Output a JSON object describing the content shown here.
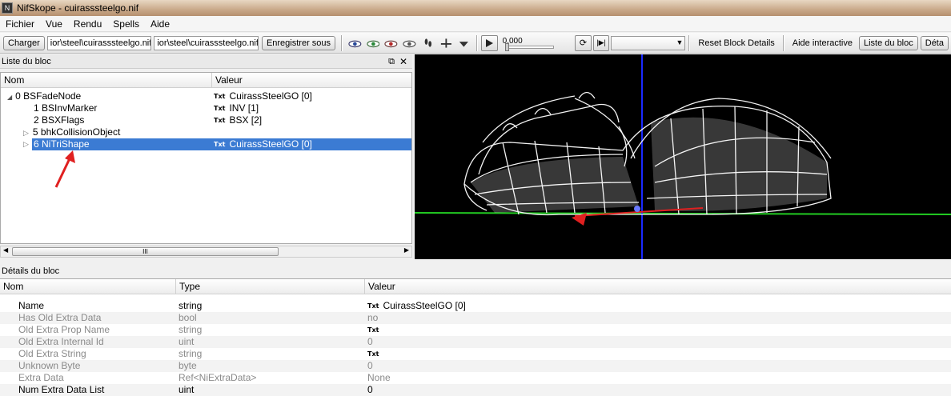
{
  "window": {
    "title": "NifSkope - cuirasssteelgo.nif"
  },
  "menu": [
    "Fichier",
    "Vue",
    "Rendu",
    "Spells",
    "Aide"
  ],
  "toolbar": {
    "load_label": "Charger",
    "path1": "ior\\steel\\cuirasssteelgo.nif",
    "path2": "ior\\steel\\cuirasssteelgo.nif",
    "save_label": "Enregistrer sous",
    "time_value": "0.000",
    "reset_label": "Reset Block Details",
    "help_label": "Aide interactive",
    "blocklist_label": "Liste du bloc",
    "details_label": "Déta"
  },
  "block_list": {
    "title": "Liste du bloc",
    "col_name": "Nom",
    "col_value": "Valeur",
    "rows": [
      {
        "name": "0 BSFadeNode",
        "value": "CuirassSteelGO [0]",
        "tag": "Txt"
      },
      {
        "name": "1 BSInvMarker",
        "value": "INV [1]",
        "tag": "Txt"
      },
      {
        "name": "2 BSXFlags",
        "value": "BSX [2]",
        "tag": "Txt"
      },
      {
        "name": "5 bhkCollisionObject",
        "value": "",
        "tag": ""
      },
      {
        "name": "6 NiTriShape",
        "value": "CuirassSteelGO [0]",
        "tag": "Txt"
      }
    ],
    "scroll_grip": "III"
  },
  "block_details": {
    "title": "Détails du bloc",
    "col_name": "Nom",
    "col_type": "Type",
    "col_value": "Valeur",
    "rows": [
      {
        "name": "Name",
        "type": "string",
        "tag": "Txt",
        "value": "CuirassSteelGO [0]"
      },
      {
        "name": "Has Old Extra Data",
        "type": "bool",
        "tag": "",
        "value": "no"
      },
      {
        "name": "Old Extra Prop Name",
        "type": "string",
        "tag": "Txt",
        "value": ""
      },
      {
        "name": "Old Extra Internal Id",
        "type": "uint",
        "tag": "",
        "value": "0"
      },
      {
        "name": "Old Extra String",
        "type": "string",
        "tag": "Txt",
        "value": ""
      },
      {
        "name": "Unknown Byte",
        "type": "byte",
        "tag": "",
        "value": "0"
      },
      {
        "name": "Extra Data",
        "type": "Ref<NiExtraData>",
        "tag": "",
        "value": "None"
      },
      {
        "name": "Num Extra Data List",
        "type": "uint",
        "tag": "",
        "value": "0"
      }
    ]
  },
  "icons": [
    "app-icon",
    "eye-icon",
    "play-icon",
    "refresh-icon",
    "step-icon",
    "dropdown-arrow-icon",
    "float-window-icon",
    "close-icon",
    "expand-arrow-icon",
    "annotation-arrow-icon"
  ],
  "colors": {
    "selection": "#3b7bd3",
    "annotation": "#e02020",
    "viewport_bg": "#000000",
    "axis_green": "#22cc22",
    "axis_blue": "#1a2aff"
  }
}
